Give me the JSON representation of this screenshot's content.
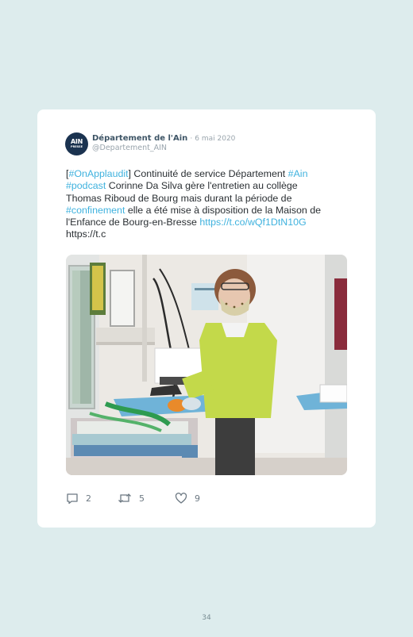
{
  "tweet": {
    "author_name": "Département de l'Ain",
    "separator": "·",
    "date": "6 mai 2020",
    "handle": "@Departement_AIN",
    "avatar_text": "AIN",
    "avatar_subtext": "PRESSE",
    "text_lines": [
      [
        {
          "t": "[",
          "link": false
        },
        {
          "t": "#OnApplaudit",
          "link": true
        },
        {
          "t": "] Continuité de service Département ",
          "link": false
        },
        {
          "t": "#Ain",
          "link": true
        }
      ],
      [
        {
          "t": "#podcast",
          "link": true
        },
        {
          "t": " Corinne Da Silva gère l'entretien au collège",
          "link": false
        }
      ],
      [
        {
          "t": "Thomas Riboud de Bourg mais durant la période de",
          "link": false
        }
      ],
      [
        {
          "t": "#confinement",
          "link": true
        },
        {
          "t": " elle a été mise à disposition de la Maison de",
          "link": false
        }
      ],
      [
        {
          "t": "l'Enfance de Bourg-en-Bresse ",
          "link": false
        },
        {
          "t": "https://t.co/wQf1DtN10G",
          "link": true
        }
      ],
      [
        {
          "t": "https://t.c",
          "link": false
        }
      ]
    ],
    "replies": "2",
    "retweets": "5",
    "likes": "9"
  },
  "colors": {
    "background": "#ddeced",
    "card": "#ffffff",
    "link": "#3fb2de",
    "text": "#2a2f33",
    "muted": "#9aa5ad"
  },
  "icons": [
    "reply-icon",
    "retweet-icon",
    "like-icon"
  ],
  "page_number": "34"
}
